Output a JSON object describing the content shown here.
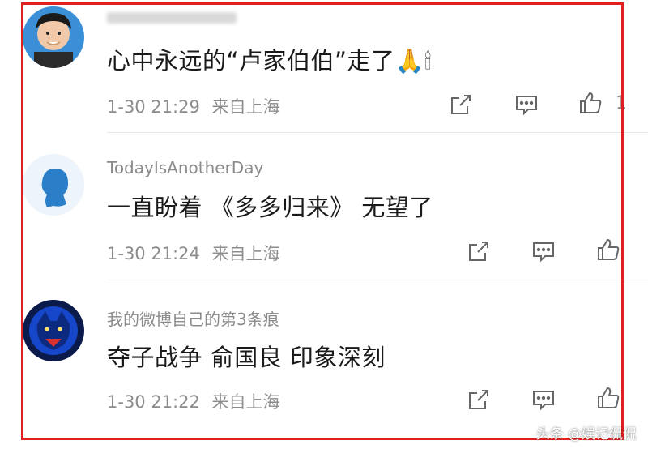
{
  "comments": [
    {
      "username": "",
      "content": "心中永远的“卢家伯伯”走了🙏🕯",
      "date": "1-30 21:29",
      "location": "来自上海",
      "like_count": "1"
    },
    {
      "username": "TodayIsAnotherDay",
      "content": "一直盼着 《多多归来》 无望了",
      "date": "1-30 21:24",
      "location": "来自上海",
      "like_count": ""
    },
    {
      "username": "我的微博自己的第3条痕",
      "content": "夺子战争 俞国良 印象深刻",
      "date": "1-30 21:22",
      "location": "来自上海",
      "like_count": ""
    }
  ],
  "watermark": "头条 @娱记侃侃",
  "colors": {
    "frame": "#e02020",
    "meta": "#8c8c8c",
    "text": "#1a1a1a"
  },
  "icons": [
    "share-icon",
    "comment-icon",
    "like-icon"
  ]
}
